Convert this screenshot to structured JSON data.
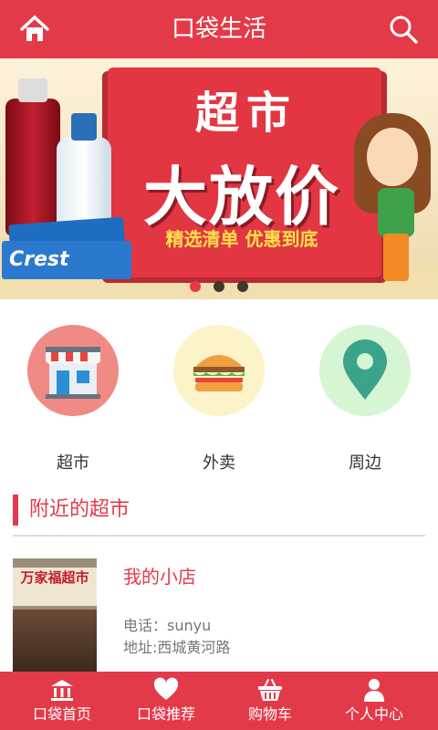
{
  "header": {
    "title": "口袋生活",
    "home_icon": "home-icon",
    "search_icon": "search-icon",
    "background": "#e33a4a"
  },
  "banner": {
    "line1": "超市",
    "line2": "大放价",
    "line3": "精选清单 优惠到底",
    "product_brand": "Crest",
    "dots_count": 3,
    "active_dot": 0
  },
  "categories": [
    {
      "label": "超市",
      "icon": "storefront-icon",
      "color": "#f08a85"
    },
    {
      "label": "外卖",
      "icon": "burger-icon",
      "color": "#fdf3c8"
    },
    {
      "label": "周边",
      "icon": "map-pin-icon",
      "color": "#d6f5d2"
    }
  ],
  "section": {
    "title": "附近的超市"
  },
  "stores": [
    {
      "name": "我的小店",
      "phone": "电话：sunyu",
      "address": "地址:西城黄河路",
      "thumb_sign": "万家福超市"
    }
  ],
  "bottom_nav": [
    {
      "label": "口袋首页",
      "icon": "bank-icon"
    },
    {
      "label": "口袋推荐",
      "icon": "heart-icon"
    },
    {
      "label": "购物车",
      "icon": "basket-icon"
    },
    {
      "label": "个人中心",
      "icon": "person-icon"
    }
  ],
  "colors": {
    "accent": "#e33a4a"
  }
}
